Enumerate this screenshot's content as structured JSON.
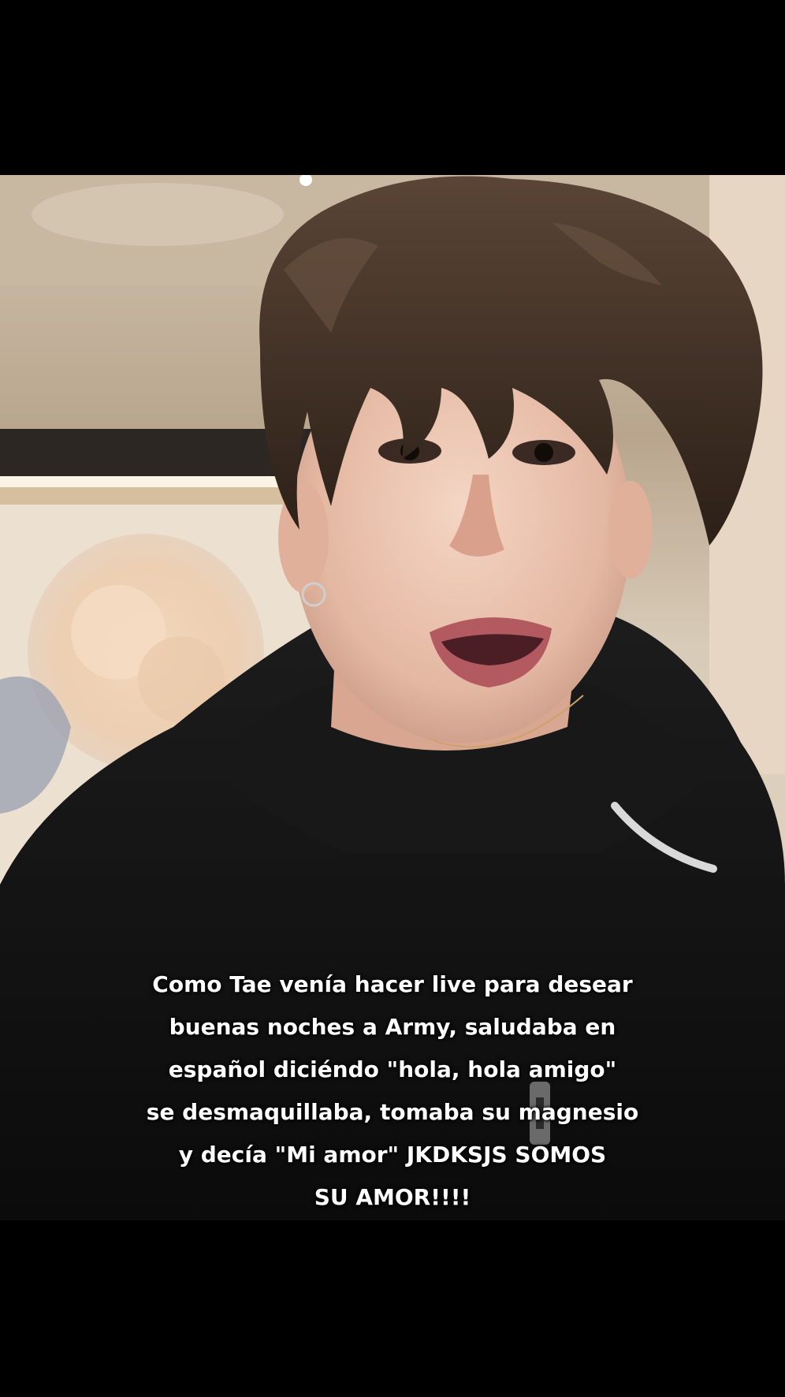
{
  "video": {
    "caption_lines": [
      "Como Tae venía hacer live para desear",
      "buenas noches a Army, saludaba en",
      "español diciéndo \"hola, hola amigo\"",
      "se desmaquillaba, tomaba su magnesio",
      "y decía \"Mi amor\" JKDKSJS SOMOS",
      "SU AMOR!!!!"
    ]
  },
  "colors": {
    "letterbox": "#000000",
    "caption_text": "#ffffff",
    "hoodie": "#141414",
    "wall": "#e8dccb"
  }
}
